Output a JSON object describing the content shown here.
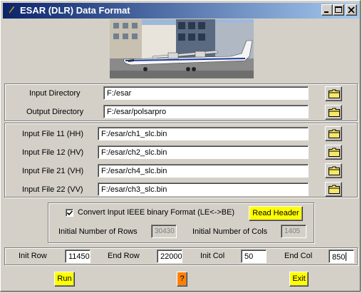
{
  "window": {
    "title": "ESAR (DLR) Data Format"
  },
  "directories": {
    "input_label": "Input Directory",
    "input_value": "F:/esar",
    "output_label": "Output Directory",
    "output_value": "F:/esar/polsarpro"
  },
  "input_files": [
    {
      "label": "Input File 11 (HH)",
      "value": "F:/esar/ch1_slc.bin"
    },
    {
      "label": "Input File 12 (HV)",
      "value": "F:/esar/ch2_slc.bin"
    },
    {
      "label": "Input File 21 (VH)",
      "value": "F:/esar/ch4_slc.bin"
    },
    {
      "label": "Input File 22 (VV)",
      "value": "F:/esar/ch3_slc.bin"
    }
  ],
  "convert": {
    "checkbox_label": "Convert Input IEEE binary Format (LE<->BE)",
    "checked": true,
    "read_header_label": "Read Header",
    "rows_label": "Initial Number of Rows",
    "rows_value": "30430",
    "cols_label": "Initial Number of Cols",
    "cols_value": "1405"
  },
  "range": {
    "init_row_label": "Init Row",
    "init_row_value": "11450",
    "end_row_label": "End Row",
    "end_row_value": "22000",
    "init_col_label": "Init Col",
    "init_col_value": "50",
    "end_col_label": "End Col",
    "end_col_value": "850"
  },
  "buttons": {
    "run": "Run",
    "help": "?",
    "exit": "Exit"
  },
  "icons": {
    "app": "feather-icon",
    "folder": "folder-icon"
  },
  "colors": {
    "title_start": "#0a246a",
    "title_end": "#a6caf0",
    "yellow_button": "#ffff00",
    "help_button": "#ff8000",
    "window_bg": "#d4d0c8"
  }
}
